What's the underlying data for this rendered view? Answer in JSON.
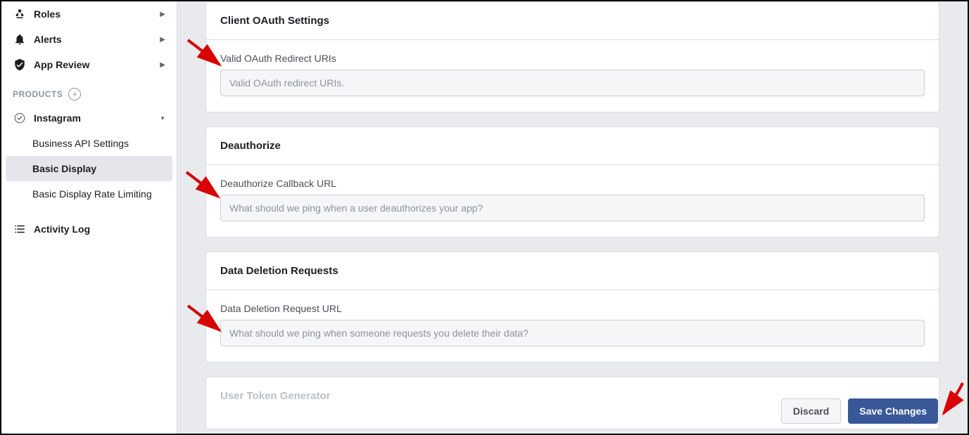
{
  "sidebar": {
    "nav": {
      "roles": "Roles",
      "alerts": "Alerts",
      "app_review": "App Review"
    },
    "products_header": "PRODUCTS",
    "instagram": {
      "label": "Instagram",
      "sub": {
        "business_api": "Business API Settings",
        "basic_display": "Basic Display",
        "rate_limiting": "Basic Display Rate Limiting"
      }
    },
    "activity_log": "Activity Log"
  },
  "cards": {
    "oauth": {
      "title": "Client OAuth Settings",
      "field_label": "Valid OAuth Redirect URIs",
      "placeholder": "Valid OAuth redirect URIs."
    },
    "deauth": {
      "title": "Deauthorize",
      "field_label": "Deauthorize Callback URL",
      "placeholder": "What should we ping when a user deauthorizes your app?"
    },
    "deletion": {
      "title": "Data Deletion Requests",
      "field_label": "Data Deletion Request URL",
      "placeholder": "What should we ping when someone requests you delete their data?"
    },
    "token": {
      "title": "User Token Generator"
    }
  },
  "footer": {
    "discard": "Discard",
    "save": "Save Changes"
  }
}
